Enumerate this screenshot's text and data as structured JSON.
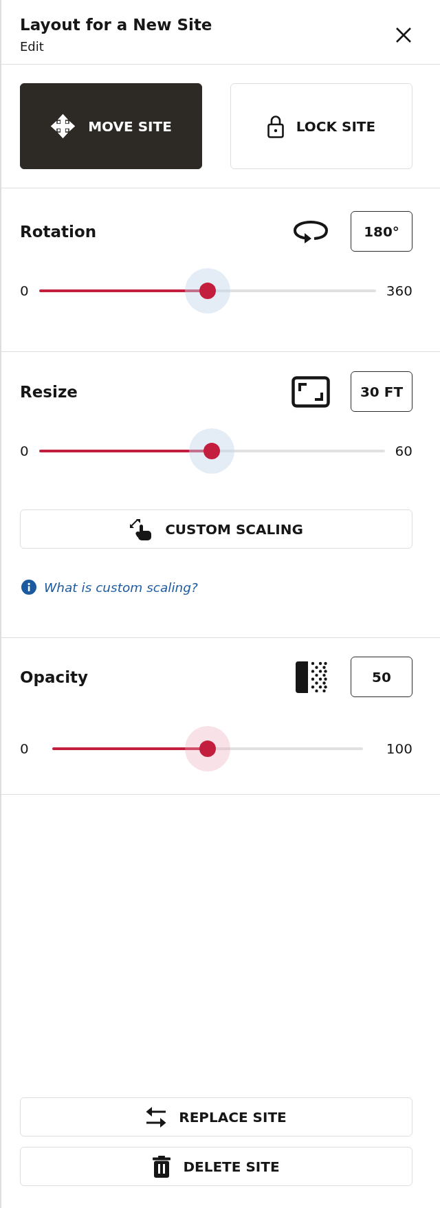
{
  "header": {
    "title": "Layout for a New Site",
    "subtitle": "Edit"
  },
  "mode_buttons": [
    {
      "kind": "move",
      "label": "MOVE SITE",
      "selected": true
    },
    {
      "kind": "lock",
      "label": "LOCK SITE",
      "selected": false
    }
  ],
  "sections": [
    {
      "kind": "rotation",
      "title": "Rotation",
      "value": "180°",
      "slider": {
        "min_label": "0",
        "max_label": "360",
        "level": 0.5,
        "focused": false
      }
    },
    {
      "kind": "resize",
      "title": "Resize",
      "value": "30 FT",
      "slider": {
        "min_label": "0",
        "max_label": "60",
        "level": 0.5,
        "focused": false
      },
      "button": "CUSTOM SCALING",
      "help_link": "What is custom scaling?"
    },
    {
      "kind": "opacity",
      "title": "Opacity",
      "value": "50",
      "slider": {
        "min_label": "0",
        "max_label": "100",
        "level": 0.5,
        "focused": true
      }
    }
  ],
  "footer_buttons": [
    {
      "kind": "replace",
      "label": "REPLACE SITE"
    },
    {
      "kind": "delete",
      "label": "DELETE SITE"
    }
  ]
}
